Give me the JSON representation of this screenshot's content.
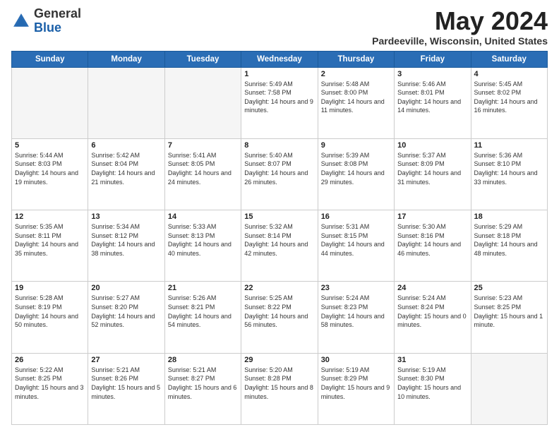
{
  "header": {
    "logo_general": "General",
    "logo_blue": "Blue",
    "month_year": "May 2024",
    "location": "Pardeeville, Wisconsin, United States"
  },
  "days_of_week": [
    "Sunday",
    "Monday",
    "Tuesday",
    "Wednesday",
    "Thursday",
    "Friday",
    "Saturday"
  ],
  "weeks": [
    [
      {
        "day": "",
        "sunrise": "",
        "sunset": "",
        "daylight": "",
        "empty": true
      },
      {
        "day": "",
        "sunrise": "",
        "sunset": "",
        "daylight": "",
        "empty": true
      },
      {
        "day": "",
        "sunrise": "",
        "sunset": "",
        "daylight": "",
        "empty": true
      },
      {
        "day": "1",
        "sunrise": "Sunrise: 5:49 AM",
        "sunset": "Sunset: 7:58 PM",
        "daylight": "Daylight: 14 hours and 9 minutes.",
        "empty": false
      },
      {
        "day": "2",
        "sunrise": "Sunrise: 5:48 AM",
        "sunset": "Sunset: 8:00 PM",
        "daylight": "Daylight: 14 hours and 11 minutes.",
        "empty": false
      },
      {
        "day": "3",
        "sunrise": "Sunrise: 5:46 AM",
        "sunset": "Sunset: 8:01 PM",
        "daylight": "Daylight: 14 hours and 14 minutes.",
        "empty": false
      },
      {
        "day": "4",
        "sunrise": "Sunrise: 5:45 AM",
        "sunset": "Sunset: 8:02 PM",
        "daylight": "Daylight: 14 hours and 16 minutes.",
        "empty": false
      }
    ],
    [
      {
        "day": "5",
        "sunrise": "Sunrise: 5:44 AM",
        "sunset": "Sunset: 8:03 PM",
        "daylight": "Daylight: 14 hours and 19 minutes.",
        "empty": false
      },
      {
        "day": "6",
        "sunrise": "Sunrise: 5:42 AM",
        "sunset": "Sunset: 8:04 PM",
        "daylight": "Daylight: 14 hours and 21 minutes.",
        "empty": false
      },
      {
        "day": "7",
        "sunrise": "Sunrise: 5:41 AM",
        "sunset": "Sunset: 8:05 PM",
        "daylight": "Daylight: 14 hours and 24 minutes.",
        "empty": false
      },
      {
        "day": "8",
        "sunrise": "Sunrise: 5:40 AM",
        "sunset": "Sunset: 8:07 PM",
        "daylight": "Daylight: 14 hours and 26 minutes.",
        "empty": false
      },
      {
        "day": "9",
        "sunrise": "Sunrise: 5:39 AM",
        "sunset": "Sunset: 8:08 PM",
        "daylight": "Daylight: 14 hours and 29 minutes.",
        "empty": false
      },
      {
        "day": "10",
        "sunrise": "Sunrise: 5:37 AM",
        "sunset": "Sunset: 8:09 PM",
        "daylight": "Daylight: 14 hours and 31 minutes.",
        "empty": false
      },
      {
        "day": "11",
        "sunrise": "Sunrise: 5:36 AM",
        "sunset": "Sunset: 8:10 PM",
        "daylight": "Daylight: 14 hours and 33 minutes.",
        "empty": false
      }
    ],
    [
      {
        "day": "12",
        "sunrise": "Sunrise: 5:35 AM",
        "sunset": "Sunset: 8:11 PM",
        "daylight": "Daylight: 14 hours and 35 minutes.",
        "empty": false
      },
      {
        "day": "13",
        "sunrise": "Sunrise: 5:34 AM",
        "sunset": "Sunset: 8:12 PM",
        "daylight": "Daylight: 14 hours and 38 minutes.",
        "empty": false
      },
      {
        "day": "14",
        "sunrise": "Sunrise: 5:33 AM",
        "sunset": "Sunset: 8:13 PM",
        "daylight": "Daylight: 14 hours and 40 minutes.",
        "empty": false
      },
      {
        "day": "15",
        "sunrise": "Sunrise: 5:32 AM",
        "sunset": "Sunset: 8:14 PM",
        "daylight": "Daylight: 14 hours and 42 minutes.",
        "empty": false
      },
      {
        "day": "16",
        "sunrise": "Sunrise: 5:31 AM",
        "sunset": "Sunset: 8:15 PM",
        "daylight": "Daylight: 14 hours and 44 minutes.",
        "empty": false
      },
      {
        "day": "17",
        "sunrise": "Sunrise: 5:30 AM",
        "sunset": "Sunset: 8:16 PM",
        "daylight": "Daylight: 14 hours and 46 minutes.",
        "empty": false
      },
      {
        "day": "18",
        "sunrise": "Sunrise: 5:29 AM",
        "sunset": "Sunset: 8:18 PM",
        "daylight": "Daylight: 14 hours and 48 minutes.",
        "empty": false
      }
    ],
    [
      {
        "day": "19",
        "sunrise": "Sunrise: 5:28 AM",
        "sunset": "Sunset: 8:19 PM",
        "daylight": "Daylight: 14 hours and 50 minutes.",
        "empty": false
      },
      {
        "day": "20",
        "sunrise": "Sunrise: 5:27 AM",
        "sunset": "Sunset: 8:20 PM",
        "daylight": "Daylight: 14 hours and 52 minutes.",
        "empty": false
      },
      {
        "day": "21",
        "sunrise": "Sunrise: 5:26 AM",
        "sunset": "Sunset: 8:21 PM",
        "daylight": "Daylight: 14 hours and 54 minutes.",
        "empty": false
      },
      {
        "day": "22",
        "sunrise": "Sunrise: 5:25 AM",
        "sunset": "Sunset: 8:22 PM",
        "daylight": "Daylight: 14 hours and 56 minutes.",
        "empty": false
      },
      {
        "day": "23",
        "sunrise": "Sunrise: 5:24 AM",
        "sunset": "Sunset: 8:23 PM",
        "daylight": "Daylight: 14 hours and 58 minutes.",
        "empty": false
      },
      {
        "day": "24",
        "sunrise": "Sunrise: 5:24 AM",
        "sunset": "Sunset: 8:24 PM",
        "daylight": "Daylight: 15 hours and 0 minutes.",
        "empty": false
      },
      {
        "day": "25",
        "sunrise": "Sunrise: 5:23 AM",
        "sunset": "Sunset: 8:25 PM",
        "daylight": "Daylight: 15 hours and 1 minute.",
        "empty": false
      }
    ],
    [
      {
        "day": "26",
        "sunrise": "Sunrise: 5:22 AM",
        "sunset": "Sunset: 8:25 PM",
        "daylight": "Daylight: 15 hours and 3 minutes.",
        "empty": false
      },
      {
        "day": "27",
        "sunrise": "Sunrise: 5:21 AM",
        "sunset": "Sunset: 8:26 PM",
        "daylight": "Daylight: 15 hours and 5 minutes.",
        "empty": false
      },
      {
        "day": "28",
        "sunrise": "Sunrise: 5:21 AM",
        "sunset": "Sunset: 8:27 PM",
        "daylight": "Daylight: 15 hours and 6 minutes.",
        "empty": false
      },
      {
        "day": "29",
        "sunrise": "Sunrise: 5:20 AM",
        "sunset": "Sunset: 8:28 PM",
        "daylight": "Daylight: 15 hours and 8 minutes.",
        "empty": false
      },
      {
        "day": "30",
        "sunrise": "Sunrise: 5:19 AM",
        "sunset": "Sunset: 8:29 PM",
        "daylight": "Daylight: 15 hours and 9 minutes.",
        "empty": false
      },
      {
        "day": "31",
        "sunrise": "Sunrise: 5:19 AM",
        "sunset": "Sunset: 8:30 PM",
        "daylight": "Daylight: 15 hours and 10 minutes.",
        "empty": false
      },
      {
        "day": "",
        "sunrise": "",
        "sunset": "",
        "daylight": "",
        "empty": true
      }
    ]
  ]
}
